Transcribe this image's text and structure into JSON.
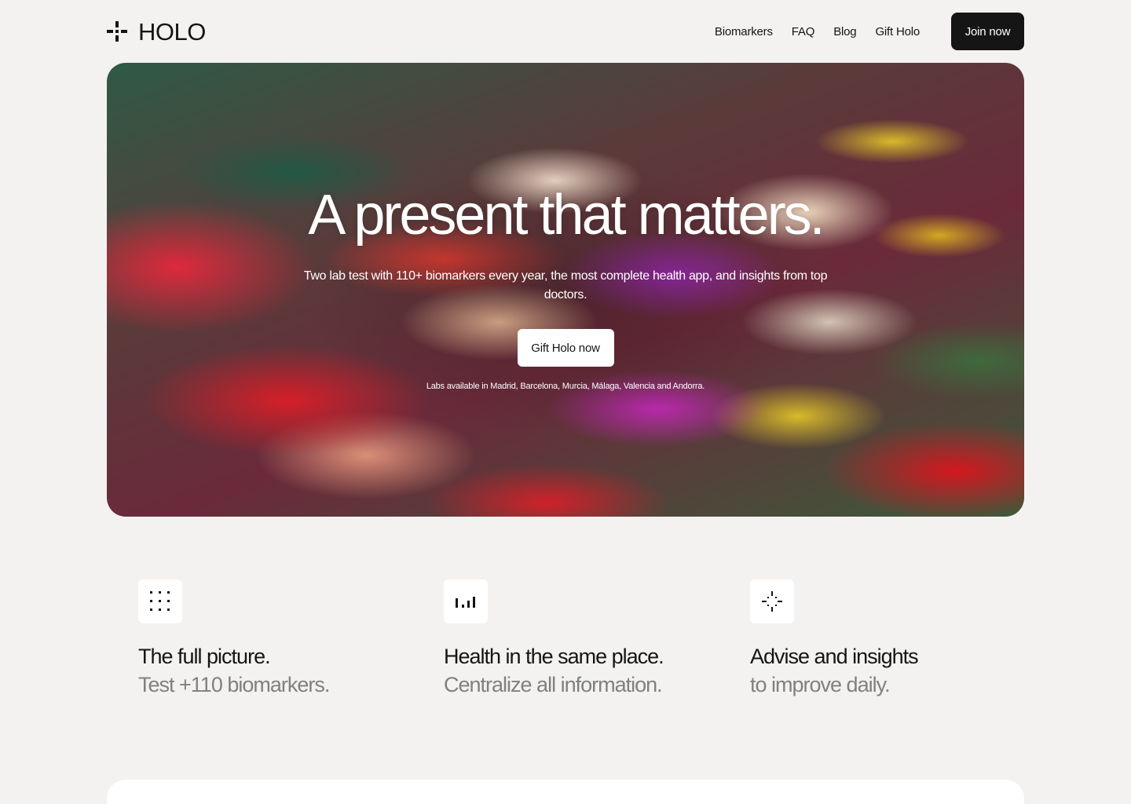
{
  "brand": {
    "name": "HOLO",
    "logo_icon": "sparkle-cross-icon"
  },
  "nav": {
    "links": [
      "Biomarkers",
      "FAQ",
      "Blog",
      "Gift Holo"
    ],
    "cta": "Join now"
  },
  "hero": {
    "title": "A present that matters.",
    "subtitle": "Two lab test with 110+ biomarkers every year, the most complete health app, and insights from top doctors.",
    "button": "Gift Holo now",
    "note": "Labs available in Madrid, Barcelona, Murcia, Málaga, Valencia and Andorra."
  },
  "features": [
    {
      "icon": "dot-grid-icon",
      "title": "The full picture.",
      "subtitle": "Test +110 biomarkers."
    },
    {
      "icon": "bar-chart-icon",
      "title": "Health in the same place.",
      "subtitle": "Centralize all information."
    },
    {
      "icon": "sparkle-icon",
      "title": "Advise and insights",
      "subtitle": "to improve daily."
    }
  ],
  "colors": {
    "background": "#f3f2f0",
    "primary": "#151515",
    "muted": "#808080",
    "card": "#ffffff"
  }
}
